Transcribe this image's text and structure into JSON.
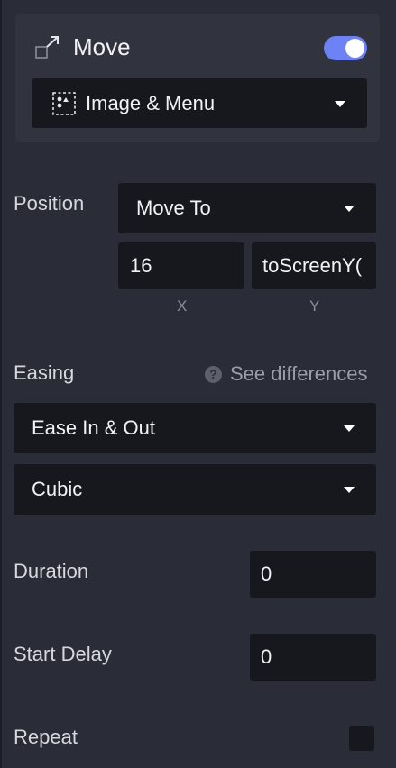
{
  "action": {
    "title": "Move",
    "enabled": true,
    "target": "Image & Menu"
  },
  "position": {
    "label": "Position",
    "mode": "Move To",
    "x_value": "16",
    "y_value": "toScreenY(",
    "x_label": "X",
    "y_label": "Y"
  },
  "easing": {
    "label": "Easing",
    "help_text": "See differences",
    "type": "Ease In & Out",
    "curve": "Cubic"
  },
  "duration": {
    "label": "Duration",
    "value": "0"
  },
  "start_delay": {
    "label": "Start Delay",
    "value": "0"
  },
  "repeat": {
    "label": "Repeat",
    "checked": false
  },
  "colors": {
    "panel_bg": "#2a2d38",
    "card_bg": "#31343f",
    "field_bg": "#16181e",
    "accent": "#6c82f5"
  }
}
